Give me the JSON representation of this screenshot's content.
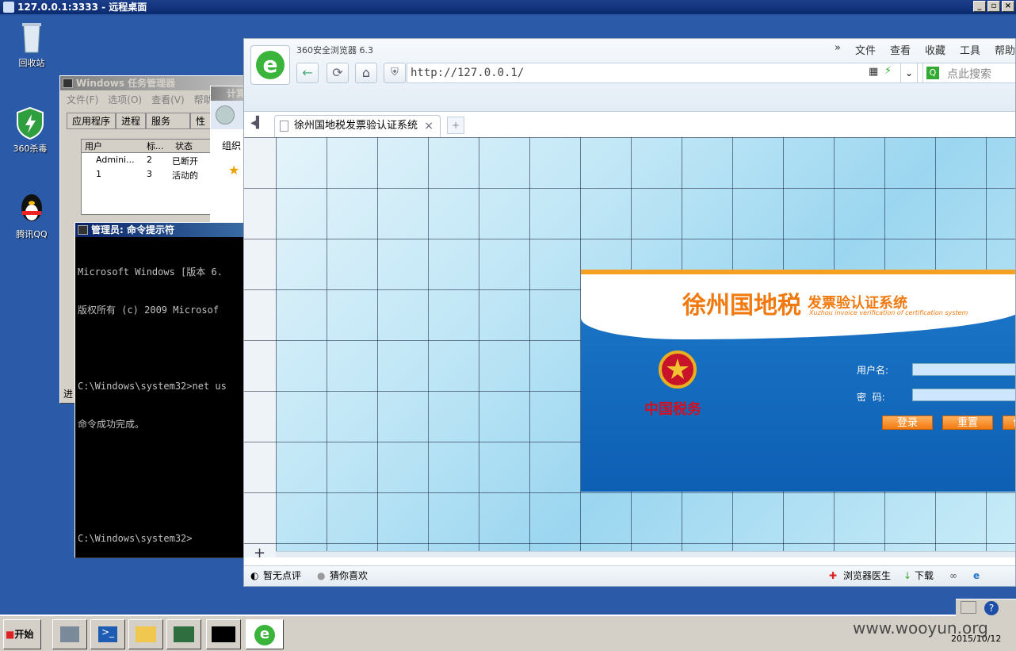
{
  "remote_desktop": {
    "title": "127.0.0.1:3333 - 远程桌面",
    "buttons": [
      "_",
      "▫",
      "×"
    ]
  },
  "desktop_icons": [
    {
      "label": "回收站",
      "icon": "recycle-bin-icon"
    },
    {
      "label": "360杀毒",
      "icon": "shield-icon"
    },
    {
      "label": "腾讯QQ",
      "icon": "qq-penguin-icon"
    }
  ],
  "task_manager": {
    "title": "Windows 任务管理器",
    "menu": [
      "文件(F)",
      "选项(O)",
      "查看(V)",
      "帮助"
    ],
    "tabs": [
      "应用程序",
      "进程",
      "服务",
      "性"
    ],
    "columns": [
      "用户",
      "标...",
      "状态"
    ],
    "rows": [
      {
        "user": "Admini...",
        "id": "2",
        "status": "已断开"
      },
      {
        "user": "1",
        "id": "3",
        "status": "活动的"
      }
    ],
    "status_fragment": "进"
  },
  "computer_window": {
    "title": "计算",
    "toolbar": "组织"
  },
  "cmd": {
    "title": "管理员: 命令提示符",
    "lines": [
      "Microsoft Windows [版本 6.",
      "版权所有 (c) 2009 Microsof",
      "",
      "C:\\Windows\\system32>net us",
      "命令成功完成。",
      "",
      "",
      "C:\\Windows\\system32>"
    ]
  },
  "browser": {
    "app_title": "360安全浏览器 6.3",
    "menu": [
      "文件",
      "查看",
      "收藏",
      "工具",
      "帮助"
    ],
    "url": "http://127.0.0.1/",
    "search_placeholder": "点此搜索",
    "tab_title": "徐州国地税发票验认证系统",
    "status_left": [
      "暂无点评",
      "猜你喜欢"
    ],
    "status_right": [
      "浏览器医生",
      "下载"
    ]
  },
  "page": {
    "system_title": "徐州国地税",
    "system_subtitle": "发票验认证系统",
    "english_subtitle": "Xuzhou invoice verification of certification system",
    "emblem_text": "中国税务",
    "username_label": "用户名:",
    "password_label": "密  码:",
    "login_button": "登录",
    "reset_button": "重置",
    "extra_button": "修"
  },
  "taskbar": {
    "start_label": "开始",
    "date": "2015/10/12"
  },
  "watermark": "www.wooyun.org",
  "colors": {
    "accent_orange": "#f07a10",
    "title_blue": "#0a246a",
    "desktop_blue": "#2a5aa8"
  }
}
